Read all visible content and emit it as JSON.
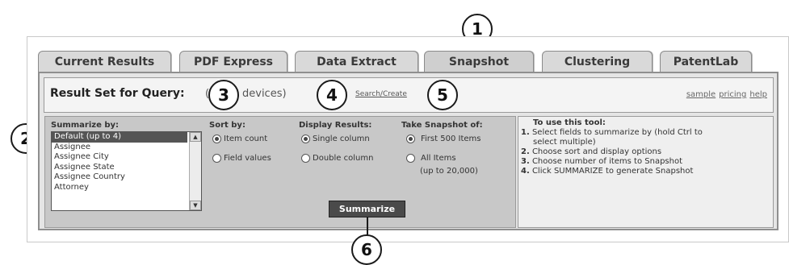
{
  "tabs": [
    "Current Results",
    "PDF Express",
    "Data Extract",
    "Snapshot",
    "Clustering",
    "PatentLab"
  ],
  "header": {
    "title": "Result Set for Query:",
    "query_part1": "(p",
    "query_part2": "devices)",
    "search_link": "Search/Create",
    "links": [
      "sample",
      "pricing",
      "help"
    ]
  },
  "summarize": {
    "label": "Summarize by:",
    "items": [
      "Default (up to 4)",
      "Assignee",
      "Assignee City",
      "Assignee State",
      "Assignee Country",
      "Attorney"
    ],
    "selected_index": 0
  },
  "sort": {
    "label": "Sort by:",
    "options": [
      "Item count",
      "Field values"
    ],
    "selected_index": 0
  },
  "display": {
    "label": "Display Results:",
    "options": [
      "Single column",
      "Double column"
    ],
    "selected_index": 0
  },
  "snapshot": {
    "label": "Take Snapshot of:",
    "options": [
      "First 500 Items",
      "All Items"
    ],
    "option2_note": "(up to 20,000)",
    "selected_index": 0
  },
  "summarize_button": "Summarize",
  "help": {
    "title": "To use this tool:",
    "steps": [
      {
        "num": "1.",
        "text": "Select fields to summarize by (hold Ctrl to"
      },
      {
        "num": "",
        "text": "select multiple)"
      },
      {
        "num": "2.",
        "text": "Choose sort and display options"
      },
      {
        "num": "3.",
        "text": "Choose number of items to Snapshot"
      },
      {
        "num": "4.",
        "text": "Click SUMMARIZE to generate Snapshot"
      }
    ]
  },
  "callouts": [
    "1",
    "2",
    "3",
    "4",
    "5",
    "6"
  ]
}
